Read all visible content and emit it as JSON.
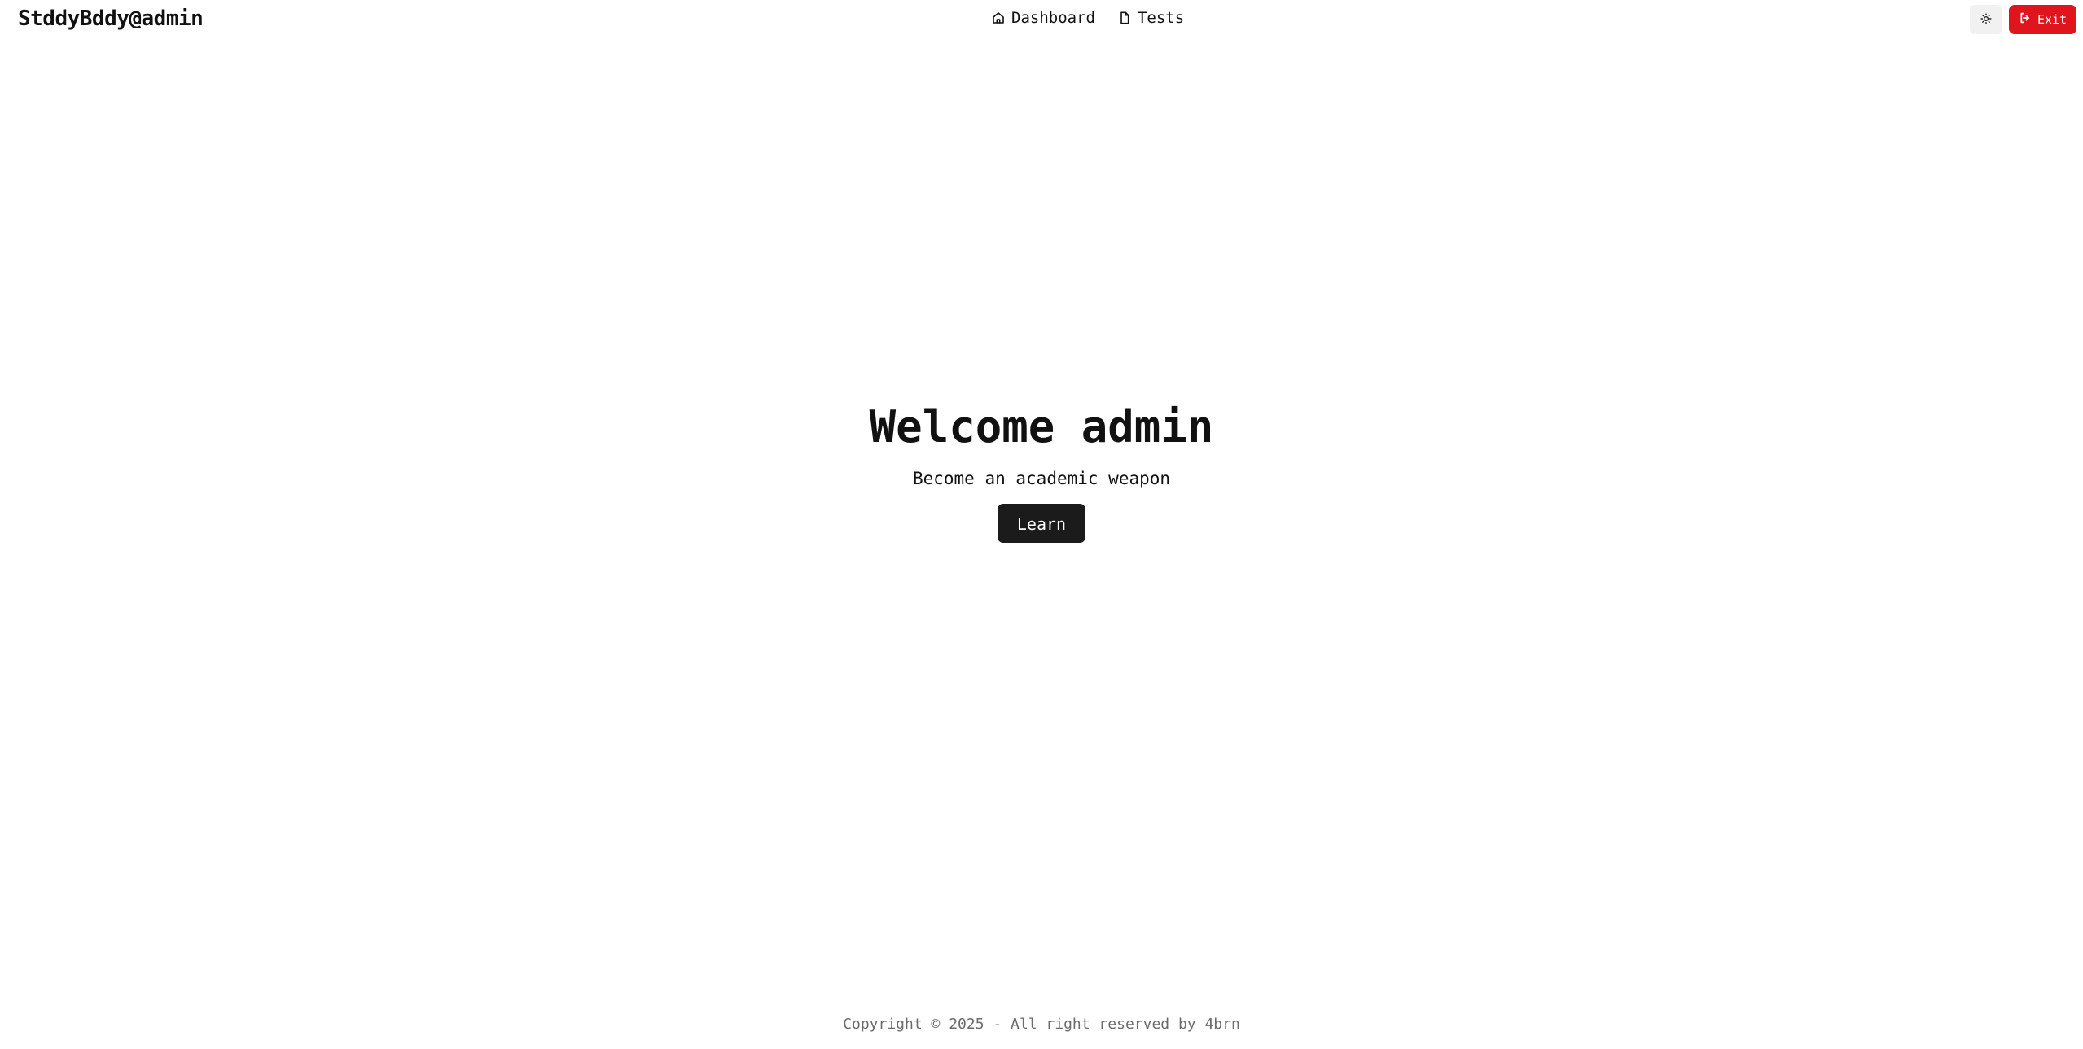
{
  "header": {
    "brand": "StddyBddy@admin",
    "nav": [
      {
        "label": "Dashboard",
        "icon": "home-icon"
      },
      {
        "label": "Tests",
        "icon": "file-icon"
      }
    ],
    "theme_toggle_icon": "sun-icon",
    "exit_label": "Exit",
    "exit_icon": "logout-icon"
  },
  "hero": {
    "title": "Welcome admin",
    "subtitle": "Become an academic weapon",
    "button_label": "Learn"
  },
  "footer": {
    "copyright": "Copyright © 2025 - All right reserved by 4brn"
  },
  "colors": {
    "exit_button": "#e0141c",
    "primary_button": "#1b1b1b",
    "background": "#ffffff"
  }
}
